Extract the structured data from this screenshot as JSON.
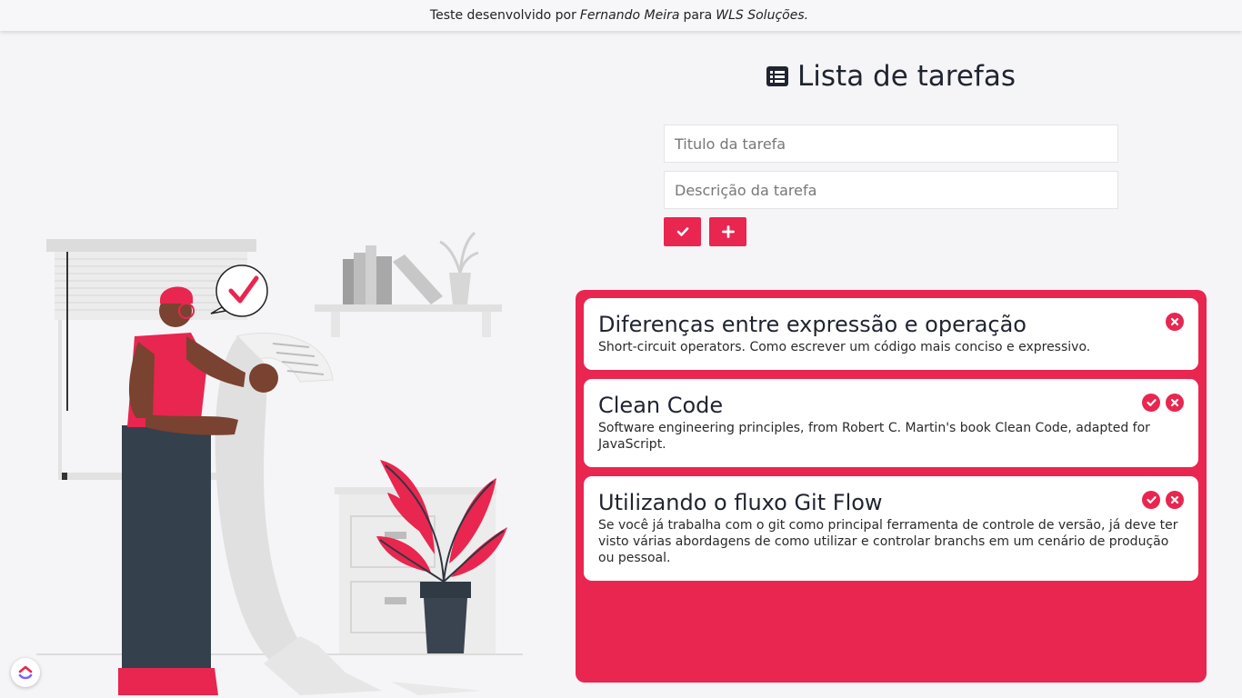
{
  "credit": {
    "prefix": "Teste desenvolvido por",
    "author": "Fernando Meira",
    "middle": "para",
    "company": "WLS Soluções."
  },
  "header": {
    "title": "Lista de tarefas",
    "icon": "list-alt-icon"
  },
  "form": {
    "title_placeholder": "Titulo da tarefa",
    "description_placeholder": "Descrição da tarefa",
    "confirm_icon": "check-icon",
    "add_icon": "plus-icon"
  },
  "tasks": [
    {
      "title": "Diferenças entre expressão e operação",
      "description": "Short-circuit operators. Como escrever um código mais conciso e expressivo.",
      "completed": true
    },
    {
      "title": "Clean Code",
      "description": "Software engineering principles, from Robert C. Martin's book Clean Code, adapted for JavaScript.",
      "completed": false
    },
    {
      "title": "Utilizando o fluxo Git Flow",
      "description": "Se você já trabalha com o git como principal ferramenta de controle de versão, já deve ter visto várias abordagens de como utilizar e controlar branchs em um cenário de produção ou pessoal.",
      "completed": false
    }
  ],
  "colors": {
    "accent": "#e8264f",
    "background": "#f5f5f7",
    "text": "#1f2430"
  }
}
